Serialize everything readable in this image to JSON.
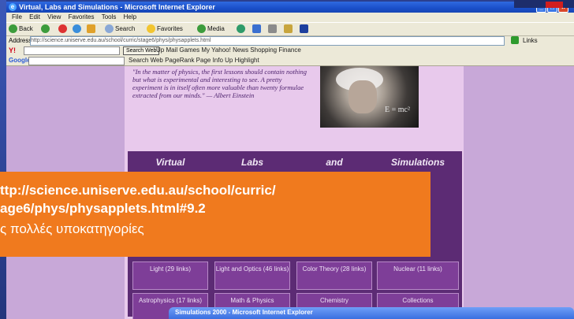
{
  "window": {
    "title": "Virtual, Labs and Simulations - Microsoft Internet Explorer",
    "controls": [
      "_",
      "□",
      "×"
    ]
  },
  "menu": [
    "File",
    "Edit",
    "View",
    "Favorites",
    "Tools",
    "Help"
  ],
  "toolbar": {
    "back": "Back",
    "search": "Search",
    "favorites": "Favorites",
    "media": "Media"
  },
  "address": {
    "label": "Address",
    "url": "http://science.uniserve.edu.au/school/curric/stage6/phys/physapplets.html",
    "links": "Links"
  },
  "yahoo_bar": {
    "logo": "Y!",
    "button": "Search Web",
    "text": "Up  Mail  Games  My Yahoo!  News  Shopping  Finance"
  },
  "google_bar": {
    "logo": "Google",
    "text": "Search Web   PageRank   Page Info   Up   Highlight"
  },
  "page": {
    "quote": "\"In the matter of physics, the first lessons should contain nothing but what is experimental and interesting to see. A pretty experiment is in itself often more valuable than twenty formulae extracted from our minds.\" — Albert Einstein",
    "photo_eq": "E = mc²",
    "headers": [
      "Virtual",
      "Labs",
      "and",
      "Simulations"
    ],
    "row_top": [
      {
        "label": "Light (29 links)"
      },
      {
        "label": "Light and Optics (46 links)"
      },
      {
        "label": "Color Theory (28 links)"
      },
      {
        "label": "Nuclear (11 links)"
      }
    ],
    "row_bottom": [
      {
        "label": "Astrophysics (17 links)"
      },
      {
        "label": "Math & Physics"
      },
      {
        "label": "Chemistry"
      },
      {
        "label": "Collections"
      }
    ]
  },
  "banner": {
    "url_line1": "ttp://science.uniserve.edu.au/school/curric/",
    "url_line2": "age6/phys/physapplets.html#9.2",
    "subtitle": "ς πολλές υποκατηγορίες"
  },
  "second_window": {
    "title": "Simulations 2000 - Microsoft Internet Explorer"
  }
}
